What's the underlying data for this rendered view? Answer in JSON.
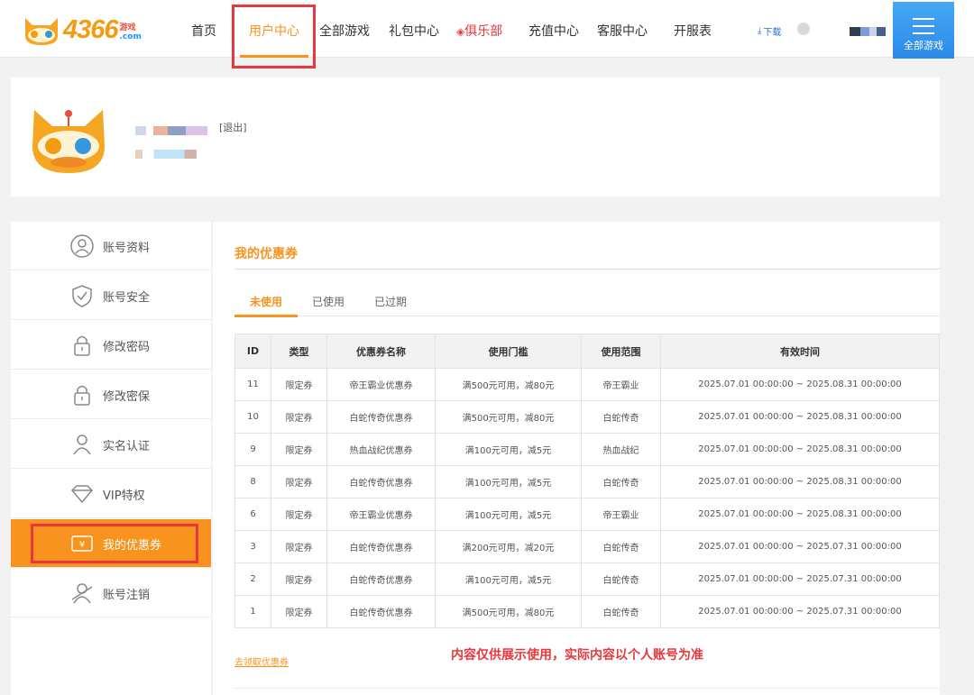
{
  "brand": {
    "name": "4366",
    "tag": "游戏",
    "domain": ".com"
  },
  "nav": {
    "items": [
      "首页",
      "用户中心",
      "全部游戏",
      "礼包中心",
      "俱乐部",
      "充值中心",
      "客服中心",
      "开服表"
    ],
    "active": "用户中心",
    "download": "下载",
    "all_games": "全部游戏"
  },
  "profile": {
    "logout": "[退出]"
  },
  "sidebar": {
    "items": [
      "账号资料",
      "账号安全",
      "修改密码",
      "修改密保",
      "实名认证",
      "VIP特权",
      "我的优惠券",
      "账号注销"
    ],
    "active": "我的优惠券"
  },
  "main": {
    "title": "我的优惠券",
    "tabs": [
      "未使用",
      "已使用",
      "已过期"
    ],
    "active_tab": "未使用",
    "get_coupon": "去领取优惠券",
    "notice": "内容仅供展示使用，实际内容以个人账号为准"
  },
  "table": {
    "columns": [
      "ID",
      "类型",
      "优惠券名称",
      "使用门槛",
      "使用范围",
      "有效时间"
    ],
    "rows": [
      [
        "11",
        "限定券",
        "帝王霸业优惠券",
        "满500元可用，减80元",
        "帝王霸业",
        "2025.07.01 00:00:00 ~ 2025.08.31 00:00:00"
      ],
      [
        "10",
        "限定券",
        "白蛇传奇优惠券",
        "满500元可用，减80元",
        "白蛇传奇",
        "2025.07.01 00:00:00 ~ 2025.08.31 00:00:00"
      ],
      [
        "9",
        "限定券",
        "热血战纪优惠券",
        "满100元可用，减5元",
        "热血战纪",
        "2025.07.01 00:00:00 ~ 2025.08.31 00:00:00"
      ],
      [
        "8",
        "限定券",
        "白蛇传奇优惠券",
        "满100元可用，减5元",
        "白蛇传奇",
        "2025.07.01 00:00:00 ~ 2025.08.31 00:00:00"
      ],
      [
        "6",
        "限定券",
        "帝王霸业优惠券",
        "满100元可用，减5元",
        "帝王霸业",
        "2025.07.01 00:00:00 ~ 2025.08.31 00:00:00"
      ],
      [
        "3",
        "限定券",
        "白蛇传奇优惠券",
        "满200元可用，减20元",
        "白蛇传奇",
        "2025.07.01 00:00:00 ~ 2025.07.31 00:00:00"
      ],
      [
        "2",
        "限定券",
        "白蛇传奇优惠券",
        "满100元可用，减5元",
        "白蛇传奇",
        "2025.07.01 00:00:00 ~ 2025.07.31 00:00:00"
      ],
      [
        "1",
        "限定券",
        "白蛇传奇优惠券",
        "满500元可用，减80元",
        "白蛇传奇",
        "2025.07.01 00:00:00 ~ 2025.07.31 00:00:00"
      ]
    ]
  },
  "colors": {
    "accent": "#f7931e",
    "highlight": "#e8383d",
    "blue": "#2b89e8"
  }
}
